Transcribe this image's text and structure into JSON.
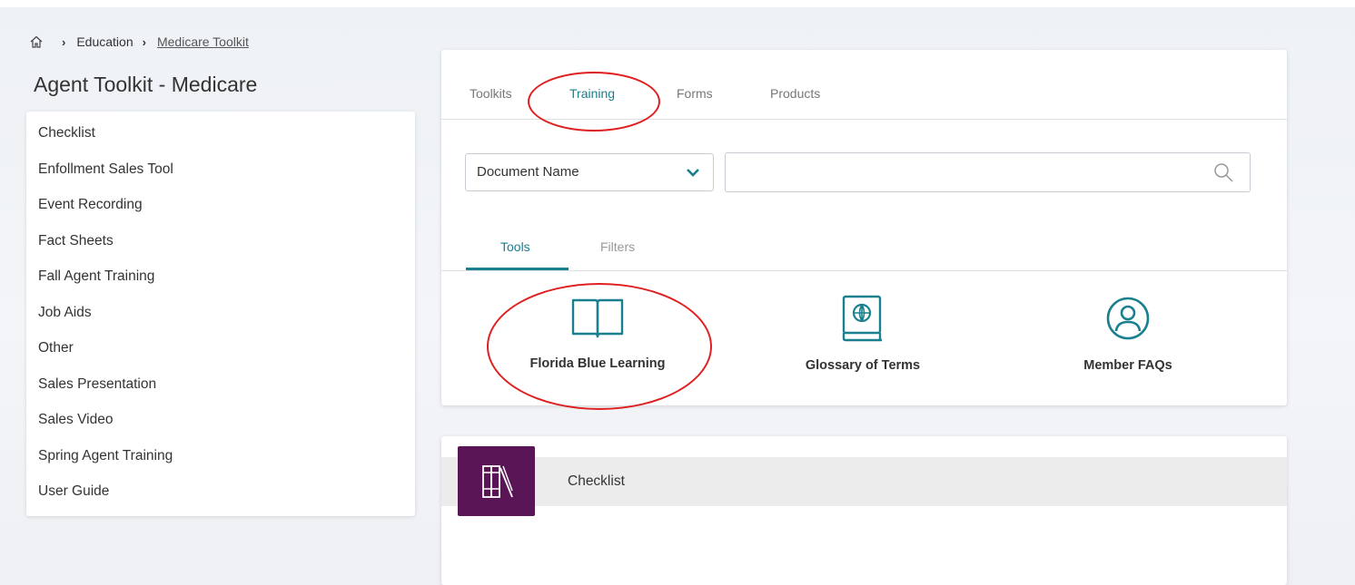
{
  "breadcrumb": {
    "home_icon": "home-icon",
    "items": [
      "Education",
      "Medicare Toolkit"
    ]
  },
  "page_title": "Agent Toolkit - Medicare",
  "sidebar": {
    "items": [
      {
        "label": "Checklist"
      },
      {
        "label": "Enfollment Sales Tool"
      },
      {
        "label": "Event Recording"
      },
      {
        "label": "Fact Sheets"
      },
      {
        "label": "Fall Agent Training"
      },
      {
        "label": "Job Aids"
      },
      {
        "label": "Other"
      },
      {
        "label": "Sales Presentation"
      },
      {
        "label": "Sales Video"
      },
      {
        "label": "Spring Agent Training"
      },
      {
        "label": "User Guide"
      }
    ]
  },
  "main": {
    "tabs": [
      {
        "label": "Toolkits"
      },
      {
        "label": "Training",
        "active": true
      },
      {
        "label": "Forms"
      },
      {
        "label": "Products"
      }
    ],
    "search": {
      "dropdown_value": "Document Name",
      "input_value": "",
      "input_placeholder": ""
    },
    "subtabs": [
      {
        "label": "Tools",
        "active": true
      },
      {
        "label": "Filters"
      }
    ],
    "tools": [
      {
        "label": "Florida Blue Learning",
        "icon": "open-book-icon"
      },
      {
        "label": "Glossary of Terms",
        "icon": "globe-book-icon"
      },
      {
        "label": "Member FAQs",
        "icon": "user-circle-icon"
      }
    ]
  },
  "results": {
    "items": [
      {
        "label": "Checklist",
        "icon": "library-books-icon"
      }
    ]
  },
  "colors": {
    "accent": "#1a7f8e",
    "tile": "#5a1557",
    "annotation": "#e02020"
  }
}
